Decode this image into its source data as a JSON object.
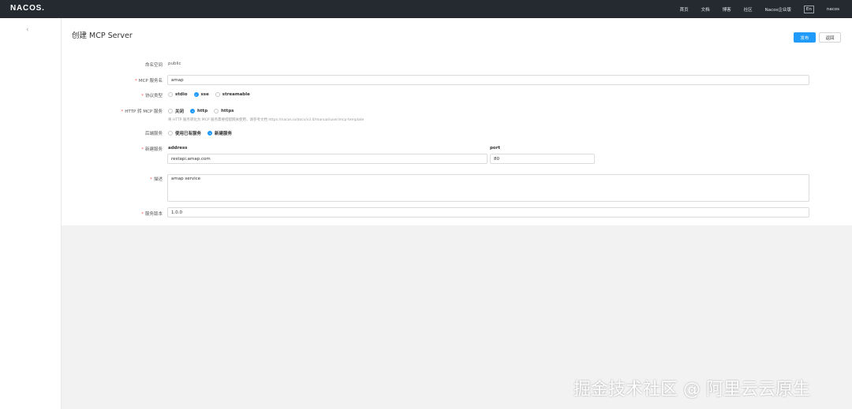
{
  "header": {
    "logo": "NACOS.",
    "nav": [
      "首页",
      "文档",
      "博客",
      "社区",
      "Nacos企业版"
    ],
    "lang": "En",
    "user": "nacos"
  },
  "sidebar": {
    "collapse_icon": "chevron-left-icon",
    "collapse_glyph": "‹"
  },
  "page": {
    "title": "创建 MCP Server",
    "publish_label": "发布",
    "back_label": "返回"
  },
  "form": {
    "namespace": {
      "label": "命名空间",
      "value": "public"
    },
    "server_name": {
      "label": "MCP 服务名",
      "value": "amap"
    },
    "protocol": {
      "label": "协议类型",
      "options": [
        "stdio",
        "sse",
        "streamable"
      ],
      "selected": "sse"
    },
    "http_to_mcp": {
      "label": "HTTP 转 MCP 服务",
      "options": [
        "关闭",
        "http",
        "https"
      ],
      "selected": "http",
      "help": "将 HTTP 服务转化为 MCP 服务需要搭配网关使用，请参考文档 https://nacos.io/docs/v3.0/manual/user/mcp-template"
    },
    "backend": {
      "label": "后端服务",
      "options": [
        "使用已有服务",
        "新建服务"
      ],
      "selected": "新建服务"
    },
    "new_service": {
      "label": "新建服务",
      "address_label": "address",
      "address_value": "restapi.amap.com",
      "port_label": "port",
      "port_value": "80"
    },
    "description": {
      "label": "描述",
      "value": "amap service"
    },
    "version": {
      "label": "服务版本",
      "value": "1.0.0"
    }
  },
  "watermark": "掘金技术社区 @ 阿里云云原生",
  "colors": {
    "topbar": "#252a31",
    "primary": "#209bfa",
    "required": "#ff4d4f"
  }
}
